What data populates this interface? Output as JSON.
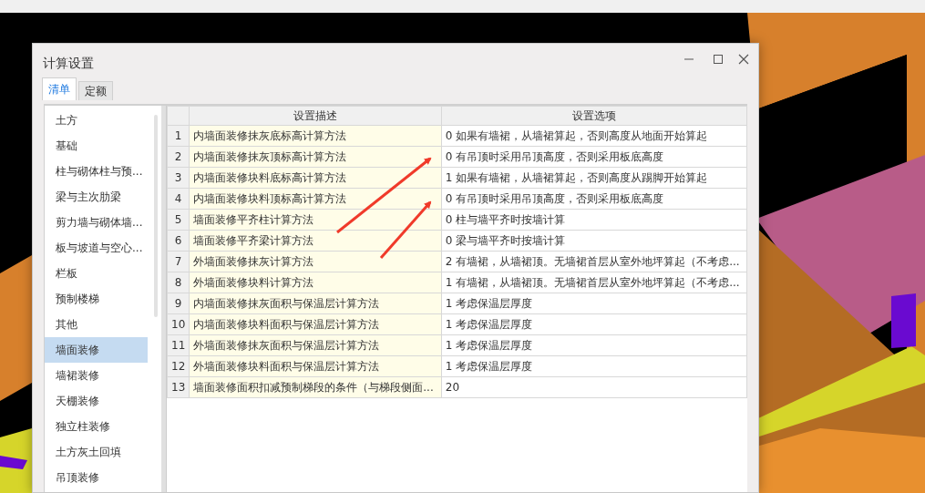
{
  "window": {
    "title": "计算设置"
  },
  "tabs": [
    {
      "label": "清单",
      "selected": true
    },
    {
      "label": "定额",
      "selected": false
    }
  ],
  "categories": [
    {
      "label": "土方",
      "selected": false
    },
    {
      "label": "基础",
      "selected": false
    },
    {
      "label": "柱与砌体柱与预...",
      "selected": false
    },
    {
      "label": "梁与主次肋梁",
      "selected": false
    },
    {
      "label": "剪力墙与砌体墙...",
      "selected": false
    },
    {
      "label": "板与坡道与空心...",
      "selected": false
    },
    {
      "label": "栏板",
      "selected": false
    },
    {
      "label": "预制楼梯",
      "selected": false
    },
    {
      "label": "其他",
      "selected": false
    },
    {
      "label": "墙面装修",
      "selected": true
    },
    {
      "label": "墙裙装修",
      "selected": false
    },
    {
      "label": "天棚装修",
      "selected": false
    },
    {
      "label": "独立柱装修",
      "selected": false
    },
    {
      "label": "土方灰土回填",
      "selected": false
    },
    {
      "label": "吊顶装修",
      "selected": false
    }
  ],
  "table": {
    "columns": [
      "设置描述",
      "设置选项"
    ],
    "rows": [
      {
        "index": "1",
        "description": "内墙面装修抹灰底标高计算方法",
        "option": "0 如果有墙裙，从墙裙算起，否则高度从地面开始算起"
      },
      {
        "index": "2",
        "description": "内墙面装修抹灰顶标高计算方法",
        "option": "0 有吊顶时采用吊顶高度，否则采用板底高度"
      },
      {
        "index": "3",
        "description": "内墙面装修块料底标高计算方法",
        "option": "1 如果有墙裙，从墙裙算起，否则高度从踢脚开始算起"
      },
      {
        "index": "4",
        "description": "内墙面装修块料顶标高计算方法",
        "option": "0 有吊顶时采用吊顶高度，否则采用板底高度"
      },
      {
        "index": "5",
        "description": "墙面装修平齐柱计算方法",
        "option": "0 柱与墙平齐时按墙计算"
      },
      {
        "index": "6",
        "description": "墙面装修平齐梁计算方法",
        "option": "0 梁与墙平齐时按墙计算"
      },
      {
        "index": "7",
        "description": "外墙面装修抹灰计算方法",
        "option": "2 有墙裙，从墙裙顶。无墙裙首层从室外地坪算起（不考虑..."
      },
      {
        "index": "8",
        "description": "外墙面装修块料计算方法",
        "option": "1 有墙裙，从墙裙顶。无墙裙首层从室外地坪算起（不考虑..."
      },
      {
        "index": "9",
        "description": "内墙面装修抹灰面积与保温层计算方法",
        "option": "1 考虑保温层厚度"
      },
      {
        "index": "10",
        "description": "内墙面装修块料面积与保温层计算方法",
        "option": "1 考虑保温层厚度"
      },
      {
        "index": "11",
        "description": "外墙面装修抹灰面积与保温层计算方法",
        "option": "1 考虑保温层厚度"
      },
      {
        "index": "12",
        "description": "外墙面装修块料面积与保温层计算方法",
        "option": "1 考虑保温层厚度"
      },
      {
        "index": "13",
        "description": "墙面装修面积扣减预制梯段的条件（与梯段侧面...",
        "option": "20"
      }
    ]
  }
}
